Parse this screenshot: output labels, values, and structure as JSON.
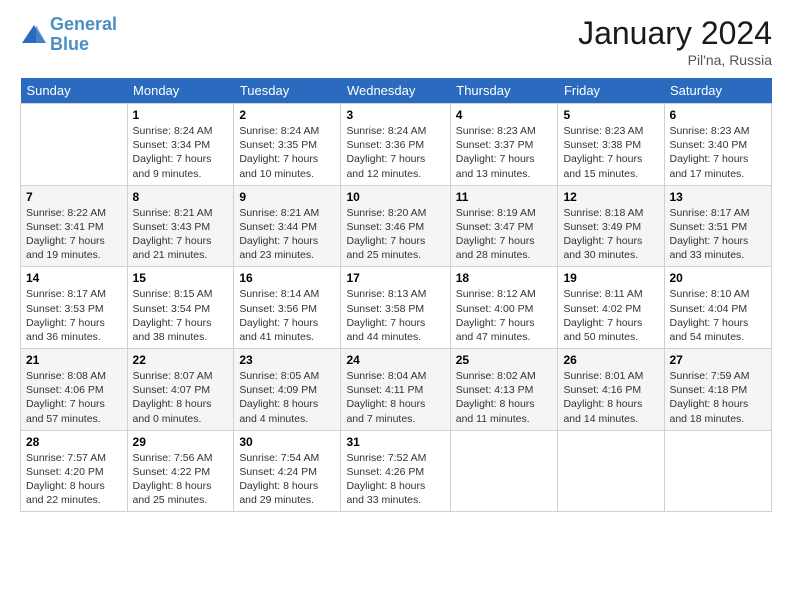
{
  "logo": {
    "line1": "General",
    "line2": "Blue"
  },
  "title": "January 2024",
  "subtitle": "Pil'na, Russia",
  "days_header": [
    "Sunday",
    "Monday",
    "Tuesday",
    "Wednesday",
    "Thursday",
    "Friday",
    "Saturday"
  ],
  "weeks": [
    [
      {
        "day": "",
        "sunrise": "",
        "sunset": "",
        "daylight": ""
      },
      {
        "day": "1",
        "sunrise": "Sunrise: 8:24 AM",
        "sunset": "Sunset: 3:34 PM",
        "daylight": "Daylight: 7 hours and 9 minutes."
      },
      {
        "day": "2",
        "sunrise": "Sunrise: 8:24 AM",
        "sunset": "Sunset: 3:35 PM",
        "daylight": "Daylight: 7 hours and 10 minutes."
      },
      {
        "day": "3",
        "sunrise": "Sunrise: 8:24 AM",
        "sunset": "Sunset: 3:36 PM",
        "daylight": "Daylight: 7 hours and 12 minutes."
      },
      {
        "day": "4",
        "sunrise": "Sunrise: 8:23 AM",
        "sunset": "Sunset: 3:37 PM",
        "daylight": "Daylight: 7 hours and 13 minutes."
      },
      {
        "day": "5",
        "sunrise": "Sunrise: 8:23 AM",
        "sunset": "Sunset: 3:38 PM",
        "daylight": "Daylight: 7 hours and 15 minutes."
      },
      {
        "day": "6",
        "sunrise": "Sunrise: 8:23 AM",
        "sunset": "Sunset: 3:40 PM",
        "daylight": "Daylight: 7 hours and 17 minutes."
      }
    ],
    [
      {
        "day": "7",
        "sunrise": "Sunrise: 8:22 AM",
        "sunset": "Sunset: 3:41 PM",
        "daylight": "Daylight: 7 hours and 19 minutes."
      },
      {
        "day": "8",
        "sunrise": "Sunrise: 8:21 AM",
        "sunset": "Sunset: 3:43 PM",
        "daylight": "Daylight: 7 hours and 21 minutes."
      },
      {
        "day": "9",
        "sunrise": "Sunrise: 8:21 AM",
        "sunset": "Sunset: 3:44 PM",
        "daylight": "Daylight: 7 hours and 23 minutes."
      },
      {
        "day": "10",
        "sunrise": "Sunrise: 8:20 AM",
        "sunset": "Sunset: 3:46 PM",
        "daylight": "Daylight: 7 hours and 25 minutes."
      },
      {
        "day": "11",
        "sunrise": "Sunrise: 8:19 AM",
        "sunset": "Sunset: 3:47 PM",
        "daylight": "Daylight: 7 hours and 28 minutes."
      },
      {
        "day": "12",
        "sunrise": "Sunrise: 8:18 AM",
        "sunset": "Sunset: 3:49 PM",
        "daylight": "Daylight: 7 hours and 30 minutes."
      },
      {
        "day": "13",
        "sunrise": "Sunrise: 8:17 AM",
        "sunset": "Sunset: 3:51 PM",
        "daylight": "Daylight: 7 hours and 33 minutes."
      }
    ],
    [
      {
        "day": "14",
        "sunrise": "Sunrise: 8:17 AM",
        "sunset": "Sunset: 3:53 PM",
        "daylight": "Daylight: 7 hours and 36 minutes."
      },
      {
        "day": "15",
        "sunrise": "Sunrise: 8:15 AM",
        "sunset": "Sunset: 3:54 PM",
        "daylight": "Daylight: 7 hours and 38 minutes."
      },
      {
        "day": "16",
        "sunrise": "Sunrise: 8:14 AM",
        "sunset": "Sunset: 3:56 PM",
        "daylight": "Daylight: 7 hours and 41 minutes."
      },
      {
        "day": "17",
        "sunrise": "Sunrise: 8:13 AM",
        "sunset": "Sunset: 3:58 PM",
        "daylight": "Daylight: 7 hours and 44 minutes."
      },
      {
        "day": "18",
        "sunrise": "Sunrise: 8:12 AM",
        "sunset": "Sunset: 4:00 PM",
        "daylight": "Daylight: 7 hours and 47 minutes."
      },
      {
        "day": "19",
        "sunrise": "Sunrise: 8:11 AM",
        "sunset": "Sunset: 4:02 PM",
        "daylight": "Daylight: 7 hours and 50 minutes."
      },
      {
        "day": "20",
        "sunrise": "Sunrise: 8:10 AM",
        "sunset": "Sunset: 4:04 PM",
        "daylight": "Daylight: 7 hours and 54 minutes."
      }
    ],
    [
      {
        "day": "21",
        "sunrise": "Sunrise: 8:08 AM",
        "sunset": "Sunset: 4:06 PM",
        "daylight": "Daylight: 7 hours and 57 minutes."
      },
      {
        "day": "22",
        "sunrise": "Sunrise: 8:07 AM",
        "sunset": "Sunset: 4:07 PM",
        "daylight": "Daylight: 8 hours and 0 minutes."
      },
      {
        "day": "23",
        "sunrise": "Sunrise: 8:05 AM",
        "sunset": "Sunset: 4:09 PM",
        "daylight": "Daylight: 8 hours and 4 minutes."
      },
      {
        "day": "24",
        "sunrise": "Sunrise: 8:04 AM",
        "sunset": "Sunset: 4:11 PM",
        "daylight": "Daylight: 8 hours and 7 minutes."
      },
      {
        "day": "25",
        "sunrise": "Sunrise: 8:02 AM",
        "sunset": "Sunset: 4:13 PM",
        "daylight": "Daylight: 8 hours and 11 minutes."
      },
      {
        "day": "26",
        "sunrise": "Sunrise: 8:01 AM",
        "sunset": "Sunset: 4:16 PM",
        "daylight": "Daylight: 8 hours and 14 minutes."
      },
      {
        "day": "27",
        "sunrise": "Sunrise: 7:59 AM",
        "sunset": "Sunset: 4:18 PM",
        "daylight": "Daylight: 8 hours and 18 minutes."
      }
    ],
    [
      {
        "day": "28",
        "sunrise": "Sunrise: 7:57 AM",
        "sunset": "Sunset: 4:20 PM",
        "daylight": "Daylight: 8 hours and 22 minutes."
      },
      {
        "day": "29",
        "sunrise": "Sunrise: 7:56 AM",
        "sunset": "Sunset: 4:22 PM",
        "daylight": "Daylight: 8 hours and 25 minutes."
      },
      {
        "day": "30",
        "sunrise": "Sunrise: 7:54 AM",
        "sunset": "Sunset: 4:24 PM",
        "daylight": "Daylight: 8 hours and 29 minutes."
      },
      {
        "day": "31",
        "sunrise": "Sunrise: 7:52 AM",
        "sunset": "Sunset: 4:26 PM",
        "daylight": "Daylight: 8 hours and 33 minutes."
      },
      {
        "day": "",
        "sunrise": "",
        "sunset": "",
        "daylight": ""
      },
      {
        "day": "",
        "sunrise": "",
        "sunset": "",
        "daylight": ""
      },
      {
        "day": "",
        "sunrise": "",
        "sunset": "",
        "daylight": ""
      }
    ]
  ]
}
